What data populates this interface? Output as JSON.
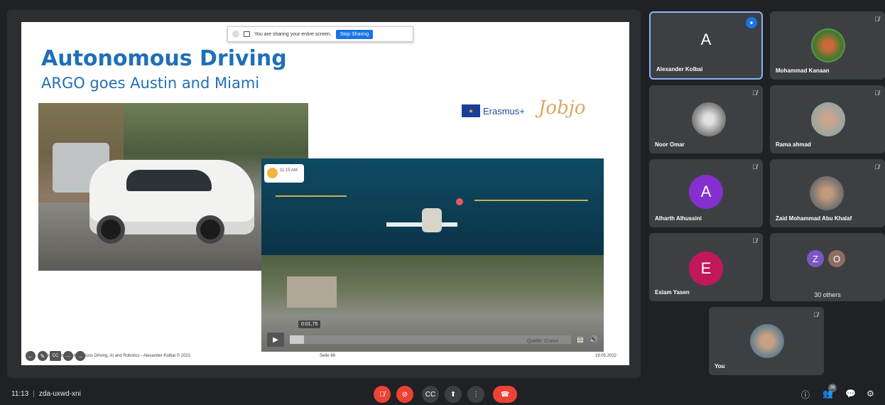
{
  "presentation": {
    "share_notice": "You are sharing your entire screen.",
    "stop_sharing": "Stop Sharing",
    "title": "Autonomous Driving",
    "subtitle": "ARGO goes Austin and Miami",
    "erasmus_label": "Erasmus+",
    "jobjo_logo": "Jobjo",
    "video_time": "0:01,75",
    "sim_clock": "11:15 AM",
    "source": "Quelle: Cruise",
    "footer_left": "Heliopolis-m... Autonomous Driving, AI and Robotics - Alexander Kolbai  © 2022",
    "footer_page": "Seite 66",
    "footer_date": "19.05.2022",
    "video_progress": 0.05
  },
  "participants": [
    {
      "name": "Alexander Kolbai",
      "initial": "A",
      "color": "#5f6368",
      "speaking": true
    },
    {
      "name": "Mohammad Kanaan",
      "muted": true,
      "photo": "plant-photo"
    },
    {
      "name": "Noor Omar",
      "muted": true,
      "photo": "gray-photo"
    },
    {
      "name": "Rama ahmad",
      "muted": true,
      "photo": "hijab-photo"
    },
    {
      "name": "Alharth Alhussini",
      "initial": "A",
      "color": "#8430ce",
      "muted": true
    },
    {
      "name": "Zaid Mohammad Abu Khalaf",
      "muted": true,
      "photo": "man-photo"
    },
    {
      "name": "Eslam Yasen",
      "initial": "E",
      "color": "#c2185b",
      "muted": true
    },
    {
      "name": "You",
      "muted": true,
      "photo": "you-photo"
    }
  ],
  "others": {
    "label": "30 others",
    "initials": [
      "Z",
      "O"
    ],
    "colors": [
      "#7e57c2",
      "#8d6e63"
    ]
  },
  "bottom_bar": {
    "time": "11:13",
    "meeting_code": "zda-uxwd-xni",
    "people_count": "39"
  },
  "icons": {
    "mic_off": "mic-off-icon",
    "cam_off": "camera-off-icon",
    "captions": "captions-icon",
    "present": "present-icon",
    "more": "more-options-icon",
    "end": "end-call-icon",
    "info": "info-icon",
    "people": "people-icon",
    "chat": "chat-icon",
    "activities": "activities-icon"
  }
}
